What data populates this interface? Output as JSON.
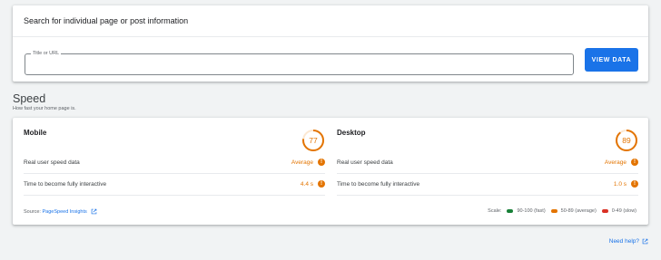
{
  "search": {
    "title": "Search for individual page or post information",
    "field_label": "Title or URL",
    "field_value": "",
    "button_label": "VIEW DATA"
  },
  "speed": {
    "title": "Speed",
    "subtitle": "How fast your home page is.",
    "mobile": {
      "title": "Mobile",
      "score": "77",
      "score_fraction": 0.77,
      "rows": [
        {
          "label": "Real user speed data",
          "value": "Average"
        },
        {
          "label": "Time to become fully interactive",
          "value": "4.4 s"
        }
      ]
    },
    "desktop": {
      "title": "Desktop",
      "score": "89",
      "score_fraction": 0.89,
      "rows": [
        {
          "label": "Real user speed data",
          "value": "Average"
        },
        {
          "label": "Time to become fully interactive",
          "value": "1.0 s"
        }
      ]
    },
    "source_prefix": "Source:",
    "source_link": "PageSpeed Insights",
    "scale_label": "Scale:",
    "scale": [
      {
        "label": "90-100 (fast)",
        "color": "#188038"
      },
      {
        "label": "50-89 (average)",
        "color": "#e37400"
      },
      {
        "label": "0-49 (slow)",
        "color": "#d93025"
      }
    ]
  },
  "help_label": "Need help?",
  "colors": {
    "accent": "#1a73e8",
    "average": "#e37400"
  },
  "icons": {
    "warning": "warning-icon",
    "external_link": "external-link-icon"
  }
}
